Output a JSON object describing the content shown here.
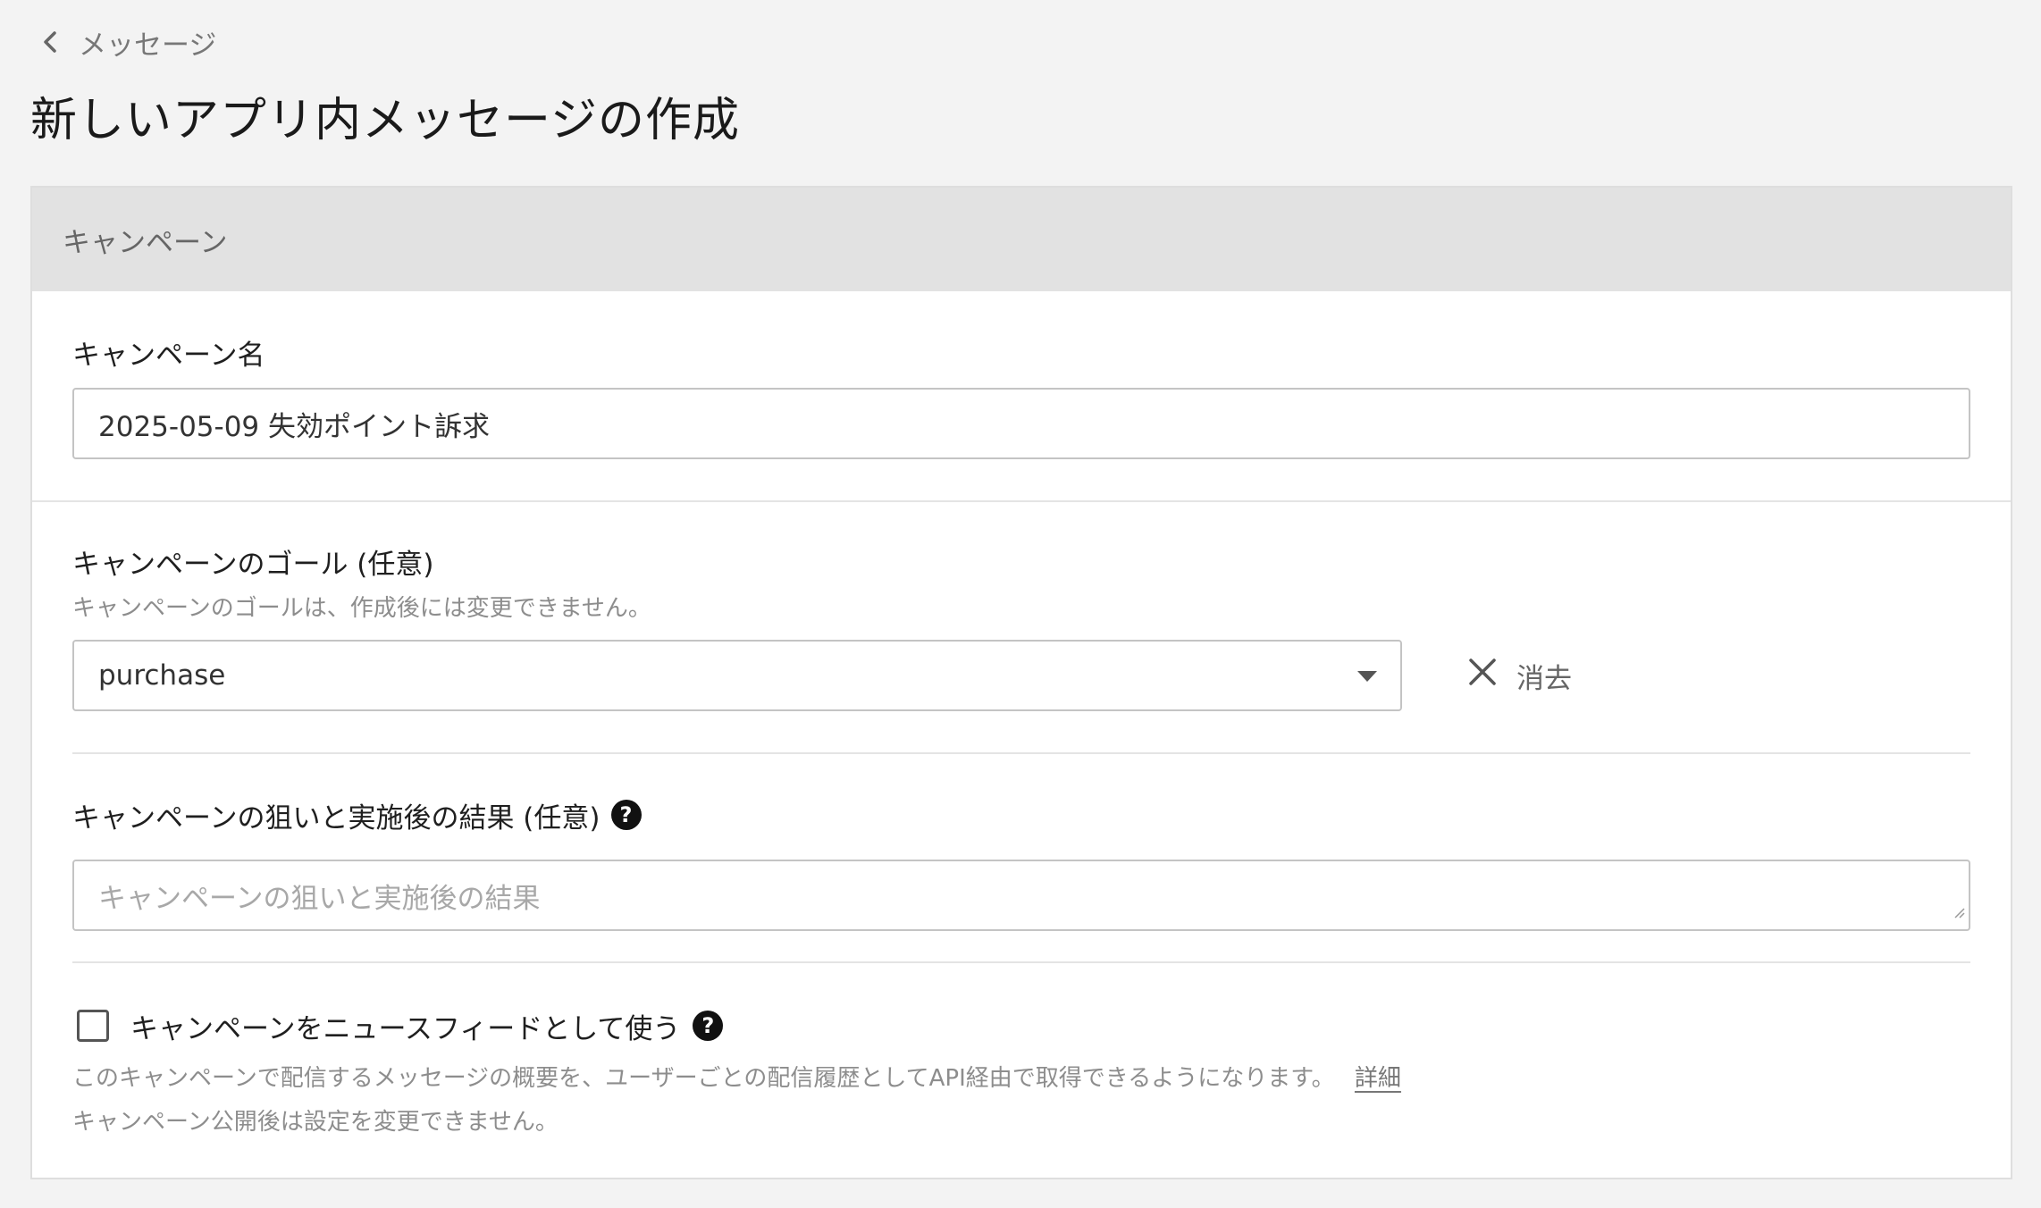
{
  "breadcrumb": {
    "label": "メッセージ"
  },
  "page": {
    "title": "新しいアプリ内メッセージの作成"
  },
  "card": {
    "header": "キャンペーン"
  },
  "campaign_name": {
    "label": "キャンペーン名",
    "value": "2025-05-09 失効ポイント訴求"
  },
  "goal": {
    "label": "キャンペーンのゴール (任意)",
    "help": "キャンペーンのゴールは、作成後には変更できません。",
    "selected": "purchase",
    "clear_label": "消去"
  },
  "aim": {
    "label": "キャンペーンの狙いと実施後の結果 (任意)",
    "placeholder": "キャンペーンの狙いと実施後の結果",
    "help_icon": "?"
  },
  "news_feed": {
    "label": "キャンペーンをニュースフィードとして使う",
    "checked": false,
    "help_icon": "?",
    "description": "このキャンペーンで配信するメッセージの概要を、ユーザーごとの配信履歴としてAPI経由で取得できるようになります。",
    "details_link": "詳細",
    "note": "キャンペーン公開後は設定を変更できません。"
  },
  "icons": [
    "chevron-left-icon",
    "chevron-down-icon",
    "close-icon",
    "question-circle-icon",
    "resize-handle-icon"
  ]
}
